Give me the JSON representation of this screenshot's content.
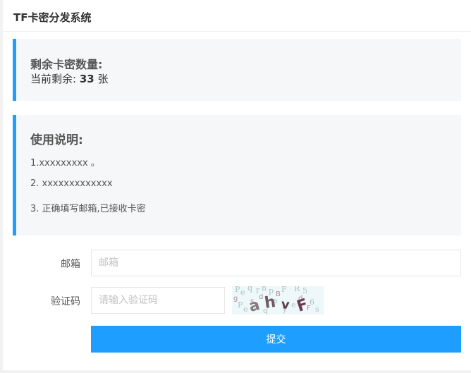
{
  "header": {
    "title": "TF卡密分发系统"
  },
  "stock": {
    "title": "剩余卡密数量:",
    "prefix": "当前剩余:",
    "count": "33",
    "unit": "张"
  },
  "instructions": {
    "title": "使用说明:",
    "items": [
      "1.xxxxxxxxx 。",
      "2. xxxxxxxxxxxxx",
      "3. 正确填写邮箱,已接收卡密"
    ]
  },
  "form": {
    "email_label": "邮箱",
    "email_placeholder": "邮箱",
    "captcha_label": "验证码",
    "captcha_placeholder": "请输入验证码",
    "captcha_text": "ahvF",
    "submit_label": "提交"
  },
  "colors": {
    "accent": "#1e9fff",
    "panel": "#f6f7f9"
  }
}
